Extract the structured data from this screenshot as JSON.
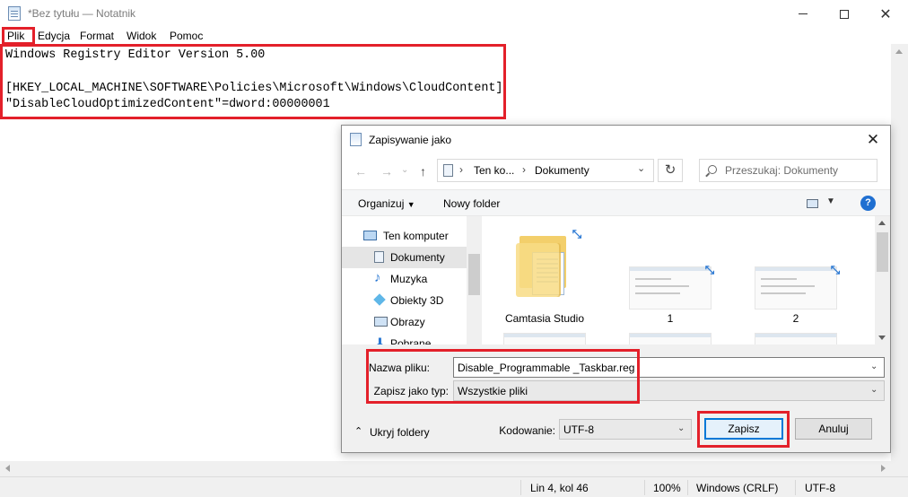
{
  "notepad": {
    "title": "*Bez tytułu — Notatnik",
    "menu": [
      "Plik",
      "Edycja",
      "Format",
      "Widok",
      "Pomoc"
    ],
    "lines": [
      "Windows Registry Editor Version 5.00",
      "",
      "[HKEY_LOCAL_MACHINE\\SOFTWARE\\Policies\\Microsoft\\Windows\\CloudContent]",
      "\"DisableCloudOptimizedContent\"=dword:00000001"
    ],
    "status": {
      "position": "Lin 4, kol 46",
      "zoom": "100%",
      "line_ending": "Windows (CRLF)",
      "encoding": "UTF-8"
    }
  },
  "dialog": {
    "title": "Zapisywanie jako",
    "close": "✕",
    "breadcrumb": [
      "Ten ko...",
      "Dokumenty"
    ],
    "search_placeholder": "Przeszukaj: Dokumenty",
    "toolbar": {
      "organize": "Organizuj",
      "new_folder": "Nowy folder",
      "help": "?"
    },
    "tree": [
      {
        "label": "Ten komputer",
        "icon": "computer-icon"
      },
      {
        "label": "Dokumenty",
        "icon": "documents-icon",
        "selected": true
      },
      {
        "label": "Muzyka",
        "icon": "music-icon"
      },
      {
        "label": "Obiekty 3D",
        "icon": "cube-icon"
      },
      {
        "label": "Obrazy",
        "icon": "pictures-icon"
      },
      {
        "label": "Pobrane",
        "icon": "downloads-icon"
      }
    ],
    "files": [
      {
        "label": "Camtasia Studio",
        "type": "folder"
      },
      {
        "label": "1",
        "type": "image"
      },
      {
        "label": "2",
        "type": "image"
      }
    ],
    "filename_label": "Nazwa pliku:",
    "filename_value": "Disable_Programmable _Taskbar.reg",
    "filetype_label": "Zapisz jako typ:",
    "filetype_value": "Wszystkie pliki",
    "hide_folders": "Ukryj foldery",
    "encoding_label": "Kodowanie:",
    "encoding_value": "UTF-8",
    "save": "Zapisz",
    "cancel": "Anuluj"
  },
  "colors": {
    "highlight": "#e3202a",
    "accent": "#0078d7"
  }
}
